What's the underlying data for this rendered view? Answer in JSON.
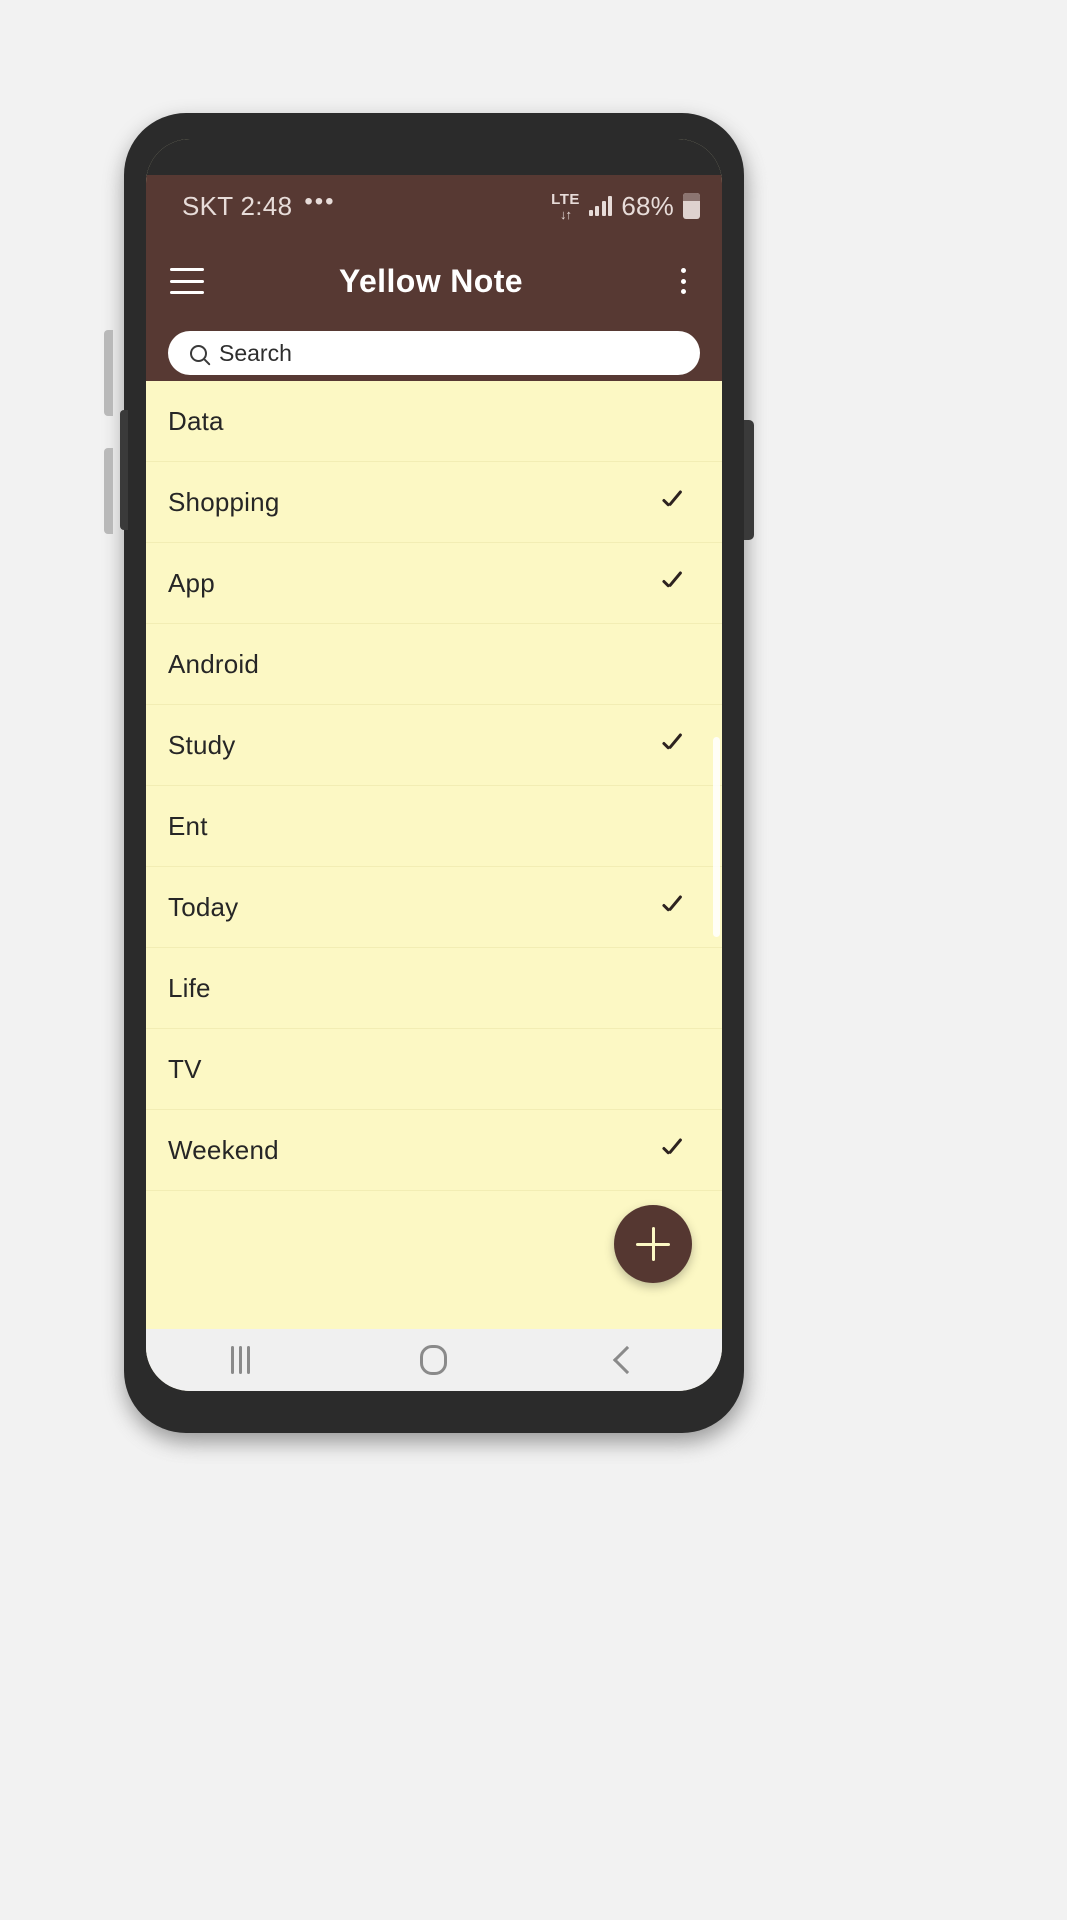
{
  "status_bar": {
    "carrier_time": "SKT 2:48",
    "overflow_dots": "•••",
    "network_type": "LTE",
    "network_arrows": "↓↑",
    "battery_percent": "68%",
    "signal_icon": "signal-bars-icon",
    "battery_icon": "battery-icon"
  },
  "app_bar": {
    "menu_icon": "hamburger-menu-icon",
    "title": "Yellow Note",
    "overflow_icon": "kebab-menu-icon"
  },
  "search": {
    "icon": "search-icon",
    "placeholder": "Search",
    "value": ""
  },
  "note_list": {
    "items": [
      {
        "label": "Data",
        "checked": false
      },
      {
        "label": "Shopping",
        "checked": true
      },
      {
        "label": "App",
        "checked": true
      },
      {
        "label": "Android",
        "checked": false
      },
      {
        "label": "Study",
        "checked": true
      },
      {
        "label": "Ent",
        "checked": false
      },
      {
        "label": "Today",
        "checked": true
      },
      {
        "label": "Life",
        "checked": false
      },
      {
        "label": "TV",
        "checked": false
      },
      {
        "label": "Weekend",
        "checked": true
      }
    ]
  },
  "fab": {
    "icon": "plus-icon",
    "label": "+"
  },
  "nav_bar": {
    "recents_icon": "recents-icon",
    "home_icon": "home-icon",
    "back_icon": "back-icon"
  },
  "colors": {
    "app_bar": "#573933",
    "note_background": "#fcf8c4",
    "fab": "#553731",
    "divider": "#f2edb4",
    "nav_bar": "#f0f0f0"
  }
}
